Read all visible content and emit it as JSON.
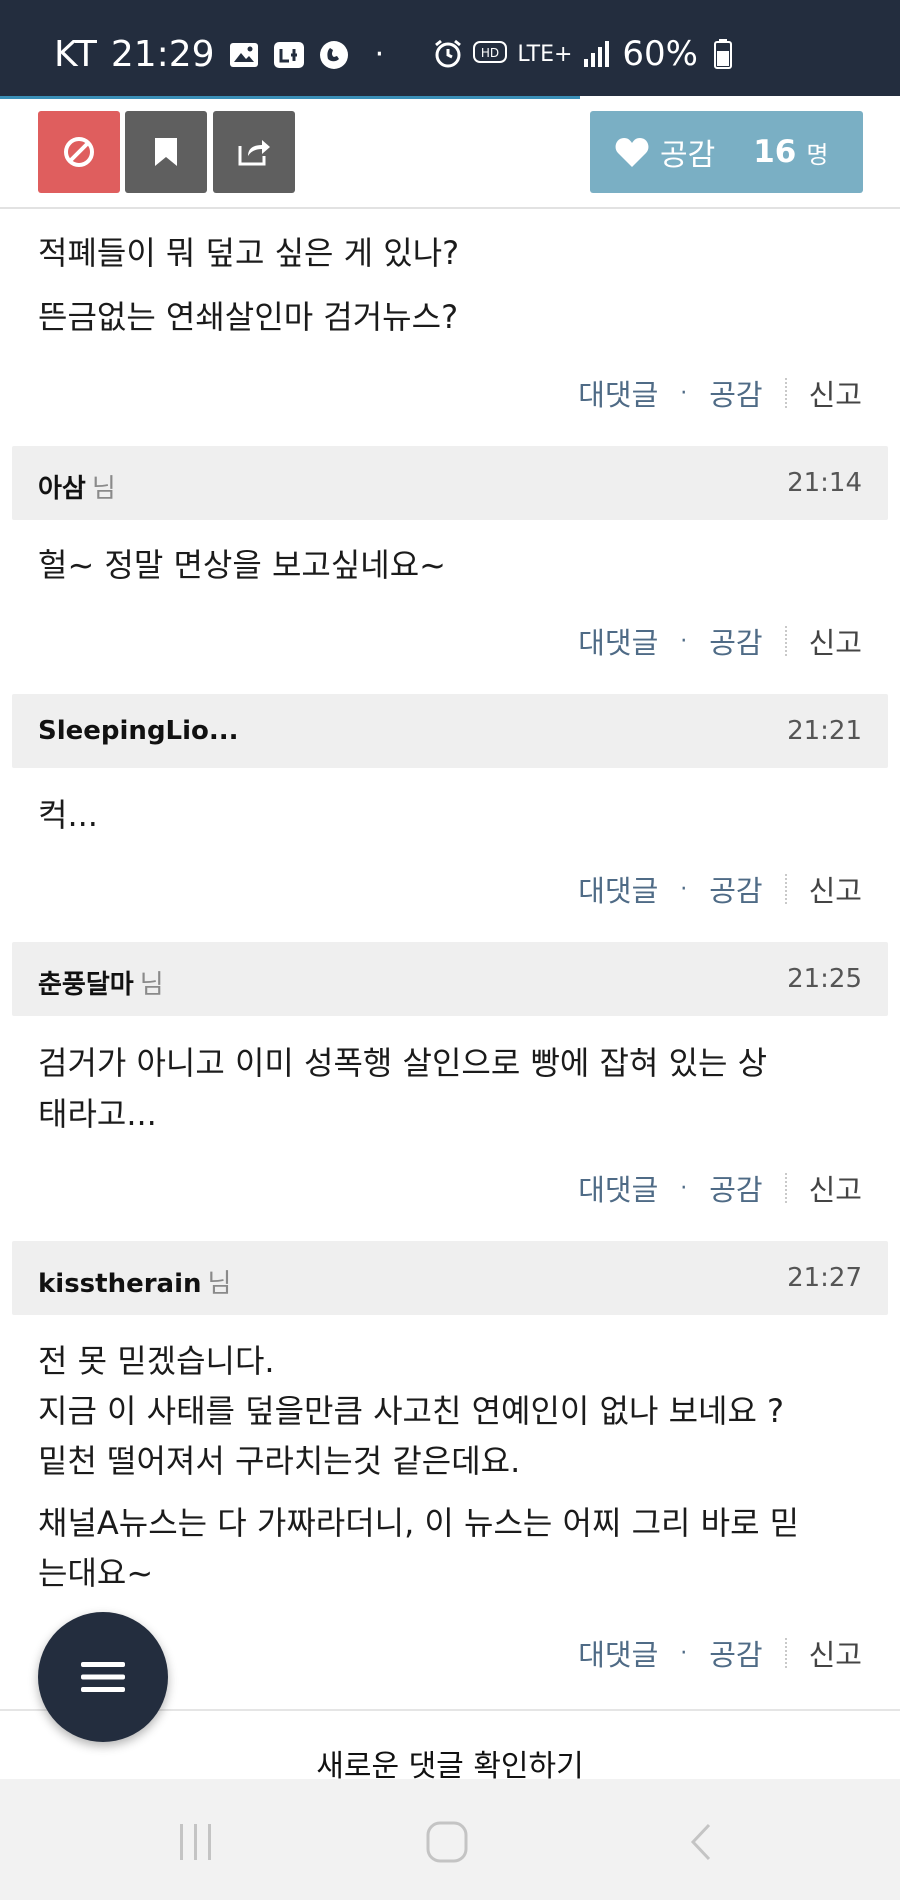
{
  "status_bar": {
    "carrier": "KT",
    "time": "21:29",
    "network": "LTE+",
    "battery": "60%"
  },
  "action_bar": {
    "like_label": "공감",
    "like_count": "16",
    "like_unit": "명"
  },
  "comment_actions": {
    "reply": "대댓글",
    "like": "공감",
    "report": "신고"
  },
  "comments": [
    {
      "lines": [
        "적폐들이 뭐 덮고 싶은 게 있나?",
        "뜬금없는 연쇄살인마 검거뉴스?"
      ]
    },
    {
      "author": "아삼",
      "honorific": "님",
      "time": "21:14",
      "lines": [
        "헐~ 정말 면상을 보고싶네요~"
      ]
    },
    {
      "author": "SleepingLio...",
      "honorific": "",
      "time": "21:21",
      "lines": [
        "컥..."
      ]
    },
    {
      "author": "춘풍달마",
      "honorific": "님",
      "time": "21:25",
      "lines": [
        "검거가 아니고 이미 성폭행 살인으로 빵에 잡혀 있는 상",
        "태라고..."
      ]
    },
    {
      "author": "kisstherain",
      "honorific": "님",
      "time": "21:27",
      "paragraph1": [
        "전 못 믿겠습니다.",
        "지금 이 사태를 덮을만큼 사고친 연예인이 없나 보네요 ?",
        "밑천 떨어져서 구라치는것 같은데요."
      ],
      "paragraph2": [
        "채널A뉴스는 다 가짜라더니, 이 뉴스는 어찌 그리 바로 믿",
        "는대요~"
      ]
    }
  ],
  "bottom": {
    "new_comments_label": "새로운 댓글 확인하기"
  },
  "colors": {
    "status_bar": "#232d3e",
    "block_button": "#df5e5e",
    "like_button": "#7aafc4",
    "action_link": "#4f6b86"
  }
}
